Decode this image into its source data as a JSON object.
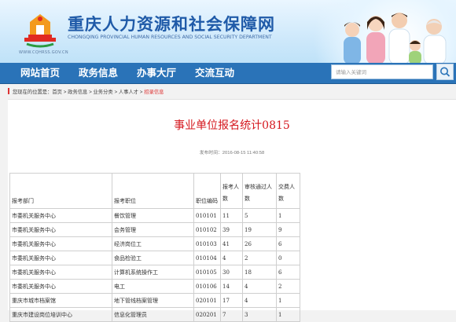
{
  "header": {
    "site_title": "重庆人力资源和社会保障网",
    "site_subtitle": "CHONGQING PROVINCIAL HUMAN RESOURCES AND SOCIAL SECURITY DEPARTMENT",
    "logo_url": "WWW.CQHRSS.GOV.CN"
  },
  "nav": {
    "items": [
      {
        "label": "网站首页"
      },
      {
        "label": "政务信息"
      },
      {
        "label": "办事大厅"
      },
      {
        "label": "交流互动"
      }
    ],
    "search_placeholder": "请输入关键词"
  },
  "breadcrumb": {
    "prefix": "您现在的位置是：",
    "path": "首页 > 政务信息 > 业务分类 > 人事人才 >",
    "current": "招录信息"
  },
  "article": {
    "title": "事业单位报名统计0815",
    "publish_time": "发布时间：2016-08-15 11:40:58"
  },
  "table": {
    "headers": [
      "报考部门",
      "报考职位",
      "职位编码",
      "报考人数",
      "审核通过人数",
      "交费人数"
    ],
    "rows": [
      [
        "市委机关服务中心",
        "餐饮管理",
        "010101",
        "11",
        "5",
        "1"
      ],
      [
        "市委机关服务中心",
        "会务管理",
        "010102",
        "39",
        "19",
        "9"
      ],
      [
        "市委机关服务中心",
        "经济岗位工",
        "010103",
        "41",
        "26",
        "6"
      ],
      [
        "市委机关服务中心",
        "食品检验工",
        "010104",
        "4",
        "2",
        "0"
      ],
      [
        "市委机关服务中心",
        "计算机系统操作工",
        "010105",
        "30",
        "18",
        "6"
      ],
      [
        "市委机关服务中心",
        "电工",
        "010106",
        "14",
        "4",
        "2"
      ],
      [
        "重庆市城市档案馆",
        "地下管线档案管理",
        "020101",
        "17",
        "4",
        "1"
      ],
      [
        "重庆市建设岗位培训中心",
        "信息化管理员",
        "020201",
        "7",
        "3",
        "1"
      ]
    ]
  },
  "colors": {
    "nav_bg": "#2a73b8",
    "title_red": "#d5171e",
    "brand_blue": "#1f5aa8"
  }
}
